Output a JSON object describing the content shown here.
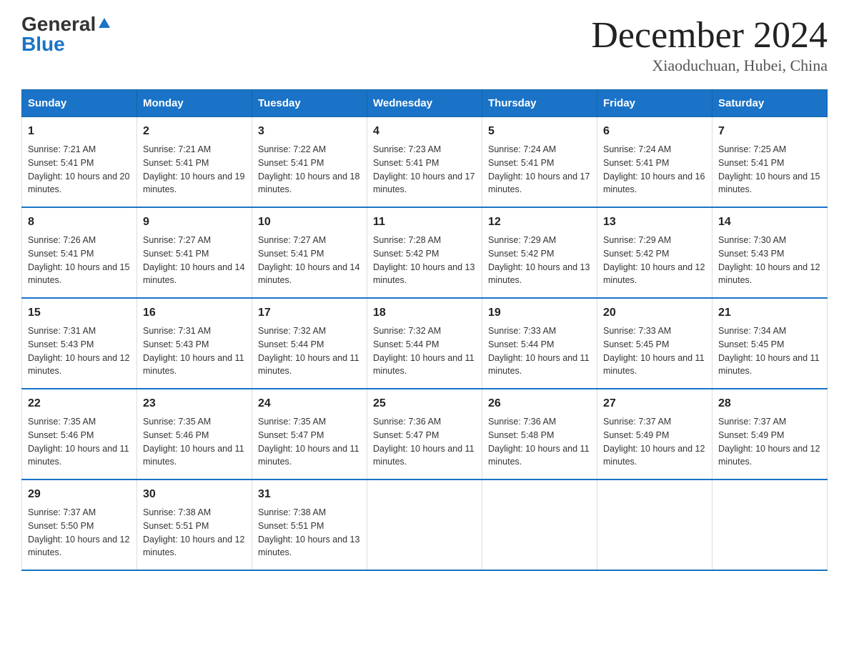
{
  "header": {
    "logo_general": "General",
    "logo_blue": "Blue",
    "title": "December 2024",
    "subtitle": "Xiaoduchuan, Hubei, China"
  },
  "days_of_week": [
    "Sunday",
    "Monday",
    "Tuesday",
    "Wednesday",
    "Thursday",
    "Friday",
    "Saturday"
  ],
  "weeks": [
    [
      {
        "day": "1",
        "sunrise": "7:21 AM",
        "sunset": "5:41 PM",
        "daylight": "10 hours and 20 minutes."
      },
      {
        "day": "2",
        "sunrise": "7:21 AM",
        "sunset": "5:41 PM",
        "daylight": "10 hours and 19 minutes."
      },
      {
        "day": "3",
        "sunrise": "7:22 AM",
        "sunset": "5:41 PM",
        "daylight": "10 hours and 18 minutes."
      },
      {
        "day": "4",
        "sunrise": "7:23 AM",
        "sunset": "5:41 PM",
        "daylight": "10 hours and 17 minutes."
      },
      {
        "day": "5",
        "sunrise": "7:24 AM",
        "sunset": "5:41 PM",
        "daylight": "10 hours and 17 minutes."
      },
      {
        "day": "6",
        "sunrise": "7:24 AM",
        "sunset": "5:41 PM",
        "daylight": "10 hours and 16 minutes."
      },
      {
        "day": "7",
        "sunrise": "7:25 AM",
        "sunset": "5:41 PM",
        "daylight": "10 hours and 15 minutes."
      }
    ],
    [
      {
        "day": "8",
        "sunrise": "7:26 AM",
        "sunset": "5:41 PM",
        "daylight": "10 hours and 15 minutes."
      },
      {
        "day": "9",
        "sunrise": "7:27 AM",
        "sunset": "5:41 PM",
        "daylight": "10 hours and 14 minutes."
      },
      {
        "day": "10",
        "sunrise": "7:27 AM",
        "sunset": "5:41 PM",
        "daylight": "10 hours and 14 minutes."
      },
      {
        "day": "11",
        "sunrise": "7:28 AM",
        "sunset": "5:42 PM",
        "daylight": "10 hours and 13 minutes."
      },
      {
        "day": "12",
        "sunrise": "7:29 AM",
        "sunset": "5:42 PM",
        "daylight": "10 hours and 13 minutes."
      },
      {
        "day": "13",
        "sunrise": "7:29 AM",
        "sunset": "5:42 PM",
        "daylight": "10 hours and 12 minutes."
      },
      {
        "day": "14",
        "sunrise": "7:30 AM",
        "sunset": "5:43 PM",
        "daylight": "10 hours and 12 minutes."
      }
    ],
    [
      {
        "day": "15",
        "sunrise": "7:31 AM",
        "sunset": "5:43 PM",
        "daylight": "10 hours and 12 minutes."
      },
      {
        "day": "16",
        "sunrise": "7:31 AM",
        "sunset": "5:43 PM",
        "daylight": "10 hours and 11 minutes."
      },
      {
        "day": "17",
        "sunrise": "7:32 AM",
        "sunset": "5:44 PM",
        "daylight": "10 hours and 11 minutes."
      },
      {
        "day": "18",
        "sunrise": "7:32 AM",
        "sunset": "5:44 PM",
        "daylight": "10 hours and 11 minutes."
      },
      {
        "day": "19",
        "sunrise": "7:33 AM",
        "sunset": "5:44 PM",
        "daylight": "10 hours and 11 minutes."
      },
      {
        "day": "20",
        "sunrise": "7:33 AM",
        "sunset": "5:45 PM",
        "daylight": "10 hours and 11 minutes."
      },
      {
        "day": "21",
        "sunrise": "7:34 AM",
        "sunset": "5:45 PM",
        "daylight": "10 hours and 11 minutes."
      }
    ],
    [
      {
        "day": "22",
        "sunrise": "7:35 AM",
        "sunset": "5:46 PM",
        "daylight": "10 hours and 11 minutes."
      },
      {
        "day": "23",
        "sunrise": "7:35 AM",
        "sunset": "5:46 PM",
        "daylight": "10 hours and 11 minutes."
      },
      {
        "day": "24",
        "sunrise": "7:35 AM",
        "sunset": "5:47 PM",
        "daylight": "10 hours and 11 minutes."
      },
      {
        "day": "25",
        "sunrise": "7:36 AM",
        "sunset": "5:47 PM",
        "daylight": "10 hours and 11 minutes."
      },
      {
        "day": "26",
        "sunrise": "7:36 AM",
        "sunset": "5:48 PM",
        "daylight": "10 hours and 11 minutes."
      },
      {
        "day": "27",
        "sunrise": "7:37 AM",
        "sunset": "5:49 PM",
        "daylight": "10 hours and 12 minutes."
      },
      {
        "day": "28",
        "sunrise": "7:37 AM",
        "sunset": "5:49 PM",
        "daylight": "10 hours and 12 minutes."
      }
    ],
    [
      {
        "day": "29",
        "sunrise": "7:37 AM",
        "sunset": "5:50 PM",
        "daylight": "10 hours and 12 minutes."
      },
      {
        "day": "30",
        "sunrise": "7:38 AM",
        "sunset": "5:51 PM",
        "daylight": "10 hours and 12 minutes."
      },
      {
        "day": "31",
        "sunrise": "7:38 AM",
        "sunset": "5:51 PM",
        "daylight": "10 hours and 13 minutes."
      },
      null,
      null,
      null,
      null
    ]
  ],
  "labels": {
    "sunrise": "Sunrise:",
    "sunset": "Sunset:",
    "daylight": "Daylight:"
  }
}
